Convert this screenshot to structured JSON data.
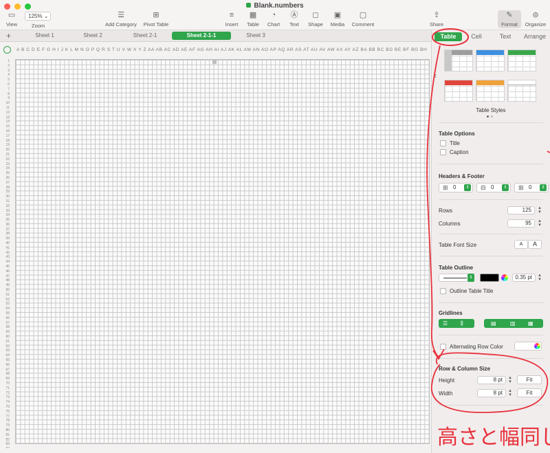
{
  "window": {
    "title": "Blank.numbers"
  },
  "toolbar": {
    "view": "View",
    "zoom_value": "125%",
    "zoom_label": "Zoom",
    "add_category": "Add Category",
    "pivot_table": "Pivot Table",
    "insert": "Insert",
    "table": "Table",
    "chart": "Chart",
    "text": "Text",
    "shape": "Shape",
    "media": "Media",
    "comment": "Comment",
    "share": "Share",
    "format": "Format",
    "organize": "Organize"
  },
  "sheets": {
    "add": "+",
    "tabs": [
      "Sheet 1",
      "Sheet 2",
      "Sheet 2-1",
      "Sheet 2-1-1",
      "Sheet 3"
    ],
    "active": "Sheet 2-1-1"
  },
  "grid": {
    "column_letters": "A B C D E F G H I J K L M N O P Q R S T U V W X Y Z AA AB AC AD AE AF AG AH AI AJ AK AL AM AN AO AP AQ AR AS AT AU AV AW AX AY AZ BA BB BC BD BE BF BG BH BI BJ BK BL BM BN BO BP BQ BR BS BT BU BV BW BX BY BZ CA CB CC CD CE CF CG CH CI CJ CK CL CM",
    "row_count": 84
  },
  "inspector": {
    "tabs": {
      "table": "Table",
      "cell": "Cell",
      "text": "Text",
      "arrange": "Arrange"
    },
    "table_styles_label": "Table Styles",
    "table_options": {
      "title": "Table Options",
      "title_label": "Title",
      "caption_label": "Caption"
    },
    "headers_footer": {
      "title": "Headers & Footer",
      "header_rows": "0",
      "header_cols": "0",
      "footer_rows": "0"
    },
    "rows": {
      "label": "Rows",
      "value": "125"
    },
    "columns": {
      "label": "Columns",
      "value": "95"
    },
    "font_size": {
      "label": "Table Font Size",
      "smaller": "A",
      "larger": "A"
    },
    "outline": {
      "title": "Table Outline",
      "width": "0.35 pt",
      "outline_title_label": "Outline Table Title"
    },
    "gridlines": {
      "title": "Gridlines"
    },
    "alternating": {
      "label": "Alternating Row Color"
    },
    "row_col_size": {
      "title": "Row & Column Size",
      "height_label": "Height",
      "height_value": "8 pt",
      "width_label": "Width",
      "width_value": "8 pt",
      "fit_label": "Fit"
    }
  },
  "annotation": {
    "handwritten_text": "高さと幅同じに"
  },
  "colors": {
    "accent_green": "#2fa54c",
    "annotation_red": "#e8323c",
    "style_blue": "#3d8fe0",
    "style_green": "#3aa84a",
    "style_red": "#e2453a",
    "style_orange": "#efa23a"
  }
}
